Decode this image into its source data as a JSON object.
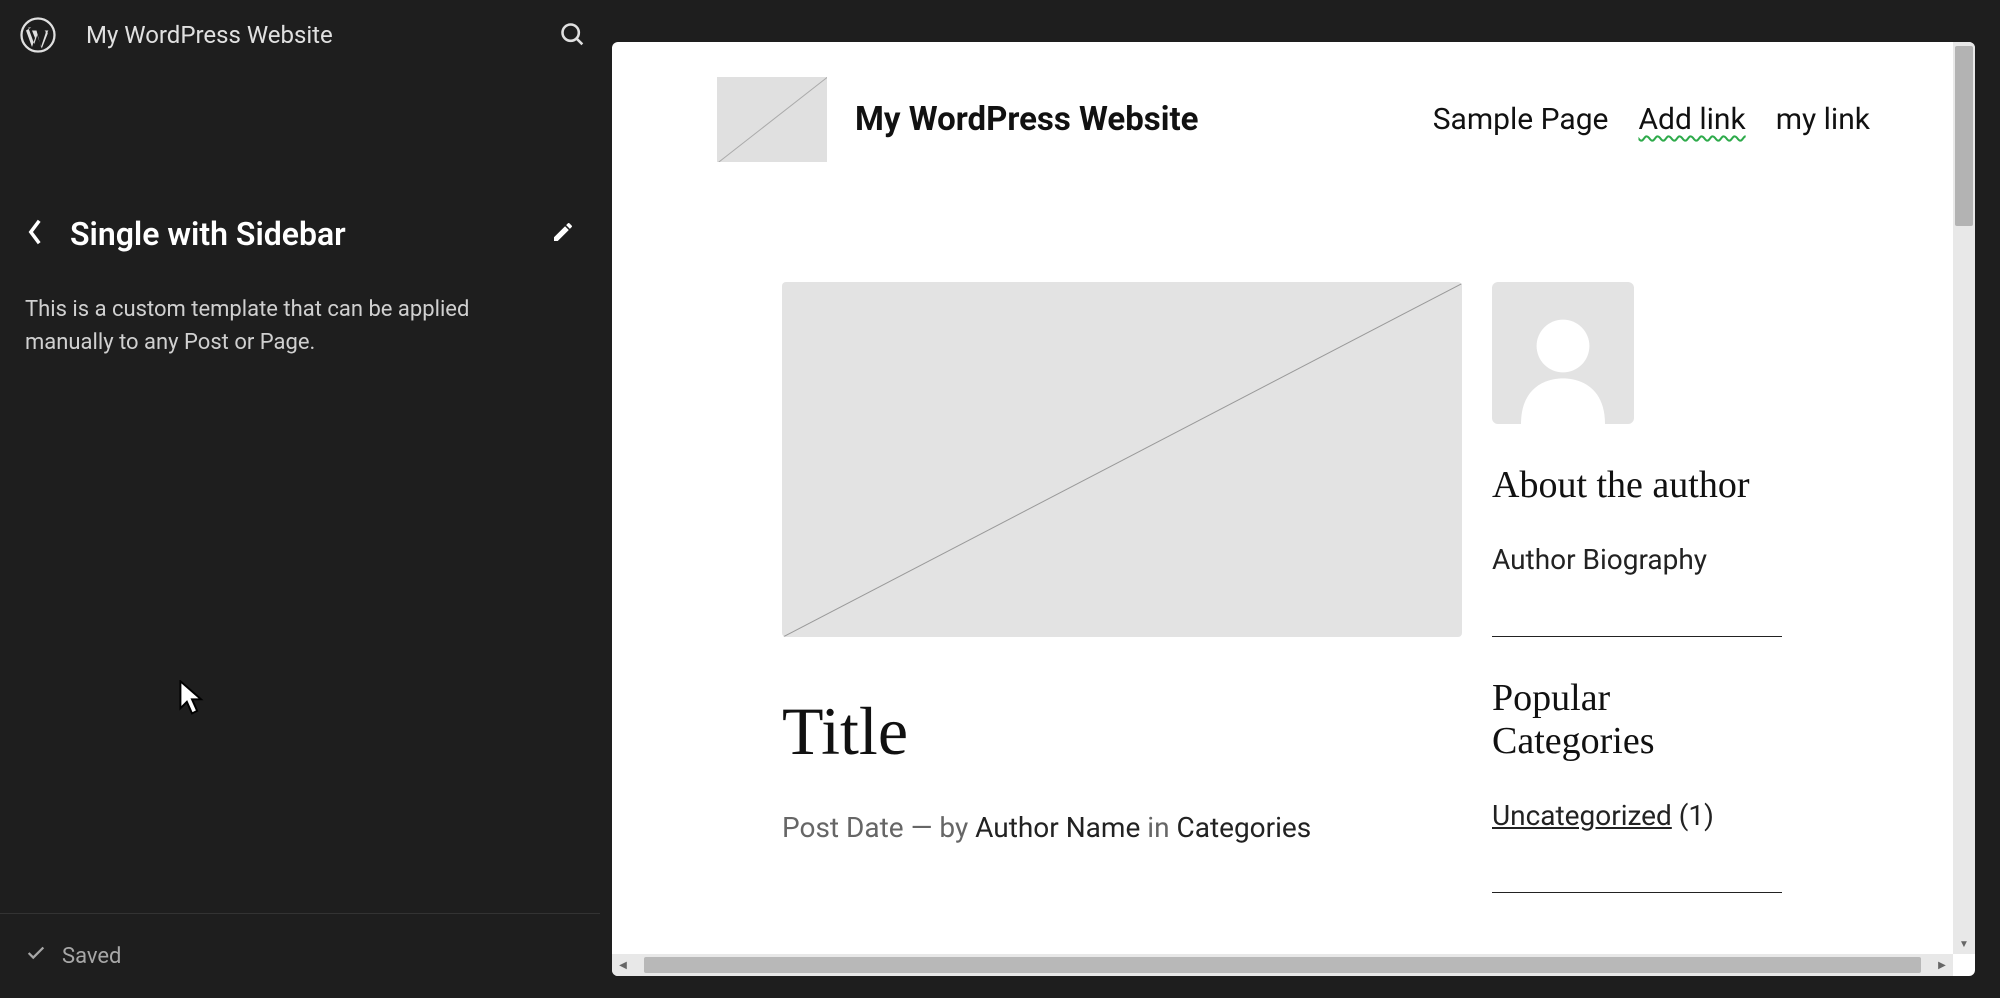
{
  "topbar": {
    "site_title": "My WordPress Website"
  },
  "sidebar": {
    "template_title": "Single with Sidebar",
    "template_description": "This is a custom template that can be applied manually to any Post or Page."
  },
  "status": {
    "saved_label": "Saved"
  },
  "preview": {
    "site_name": "My WordPress Website",
    "nav": {
      "item1": "Sample Page",
      "item2": "Add link",
      "item3": "my link"
    },
    "post": {
      "title": "Title",
      "meta_date": "Post Date",
      "meta_sep": " — ",
      "meta_by": "by ",
      "meta_author": "Author Name",
      "meta_in": " in ",
      "meta_categories": "Categories"
    },
    "aside": {
      "about_heading": "About the author",
      "about_bio": "Author Biography",
      "popular_heading": "Popular Categories",
      "cat_name": "Uncategorized",
      "cat_count": " (1)"
    }
  }
}
